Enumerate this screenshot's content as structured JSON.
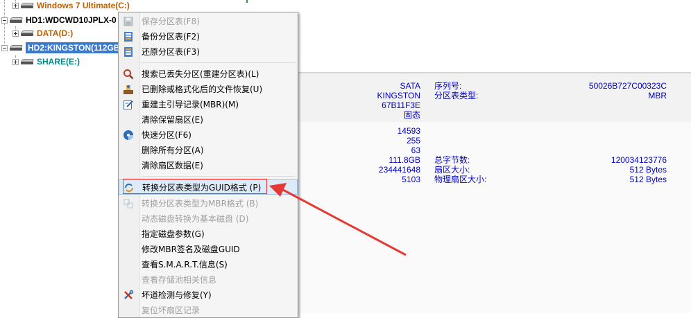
{
  "tree": {
    "win7": "Windows 7 Ultimate(C:)",
    "hd1": "HD1:WDCWD10JPLX-0",
    "data": "DATA(D:)",
    "hd2": "HD2:KINGSTON(112GB",
    "share": "SHARE(E:)"
  },
  "disk_info": {
    "interface": "SATA",
    "model": "KINGSTON",
    "serial_id": "67B11F3E",
    "type": "固态",
    "serial_label": "序列号:",
    "serial_value": "50026B727C00323C",
    "pt_label": "分区表类型:",
    "pt_value": "MBR",
    "cylinders": "14593",
    "heads": "255",
    "sectors": "63",
    "capacity": "111.8GB",
    "total_sectors": "234441648",
    "extra": "5103",
    "total_bytes_label": "总字节数:",
    "total_bytes_value": "120034123776",
    "sector_size_label": "扇区大小:",
    "sector_size_value": "512 Bytes",
    "phys_sector_label": "物理扇区大小:",
    "phys_sector_value": "512 Bytes"
  },
  "menu": {
    "save_pt": "保存分区表(F8)",
    "backup_pt": "备份分区表(F2)",
    "restore_pt": "还原分区表(F3)",
    "search_lost": "搜索已丢失分区(重建分区表)(L)",
    "recover_files": "已删除或格式化后的文件恢复(U)",
    "rebuild_mbr": "重建主引导记录(MBR)(M)",
    "clear_reserved": "清除保留扇区(E)",
    "quick_part": "快速分区(F6)",
    "delete_all": "删除所有分区(A)",
    "clear_sectors": "清除扇区数据(E)",
    "to_guid": "转换分区表类型为GUID格式 (P)",
    "to_mbr": "转换分区表类型为MBR格式 (B)",
    "dyn_to_basic": "动态磁盘转换为基本磁盘 (D)",
    "set_params": "指定磁盘参数(G)",
    "modify_sig": "修改MBR签名及磁盘GUID",
    "smart": "查看S.M.A.R.T.信息(S)",
    "storage_pool": "查看存储池相关信息",
    "bad_track": "坏道检测与修复(Y)",
    "reset_bad": "复位坏扇区记录"
  },
  "colors": {
    "selection": "#3979d0",
    "value_text": "#0000cc",
    "orange_part": "#c06000",
    "teal_part": "#008b8b",
    "callout": "#e53935"
  }
}
